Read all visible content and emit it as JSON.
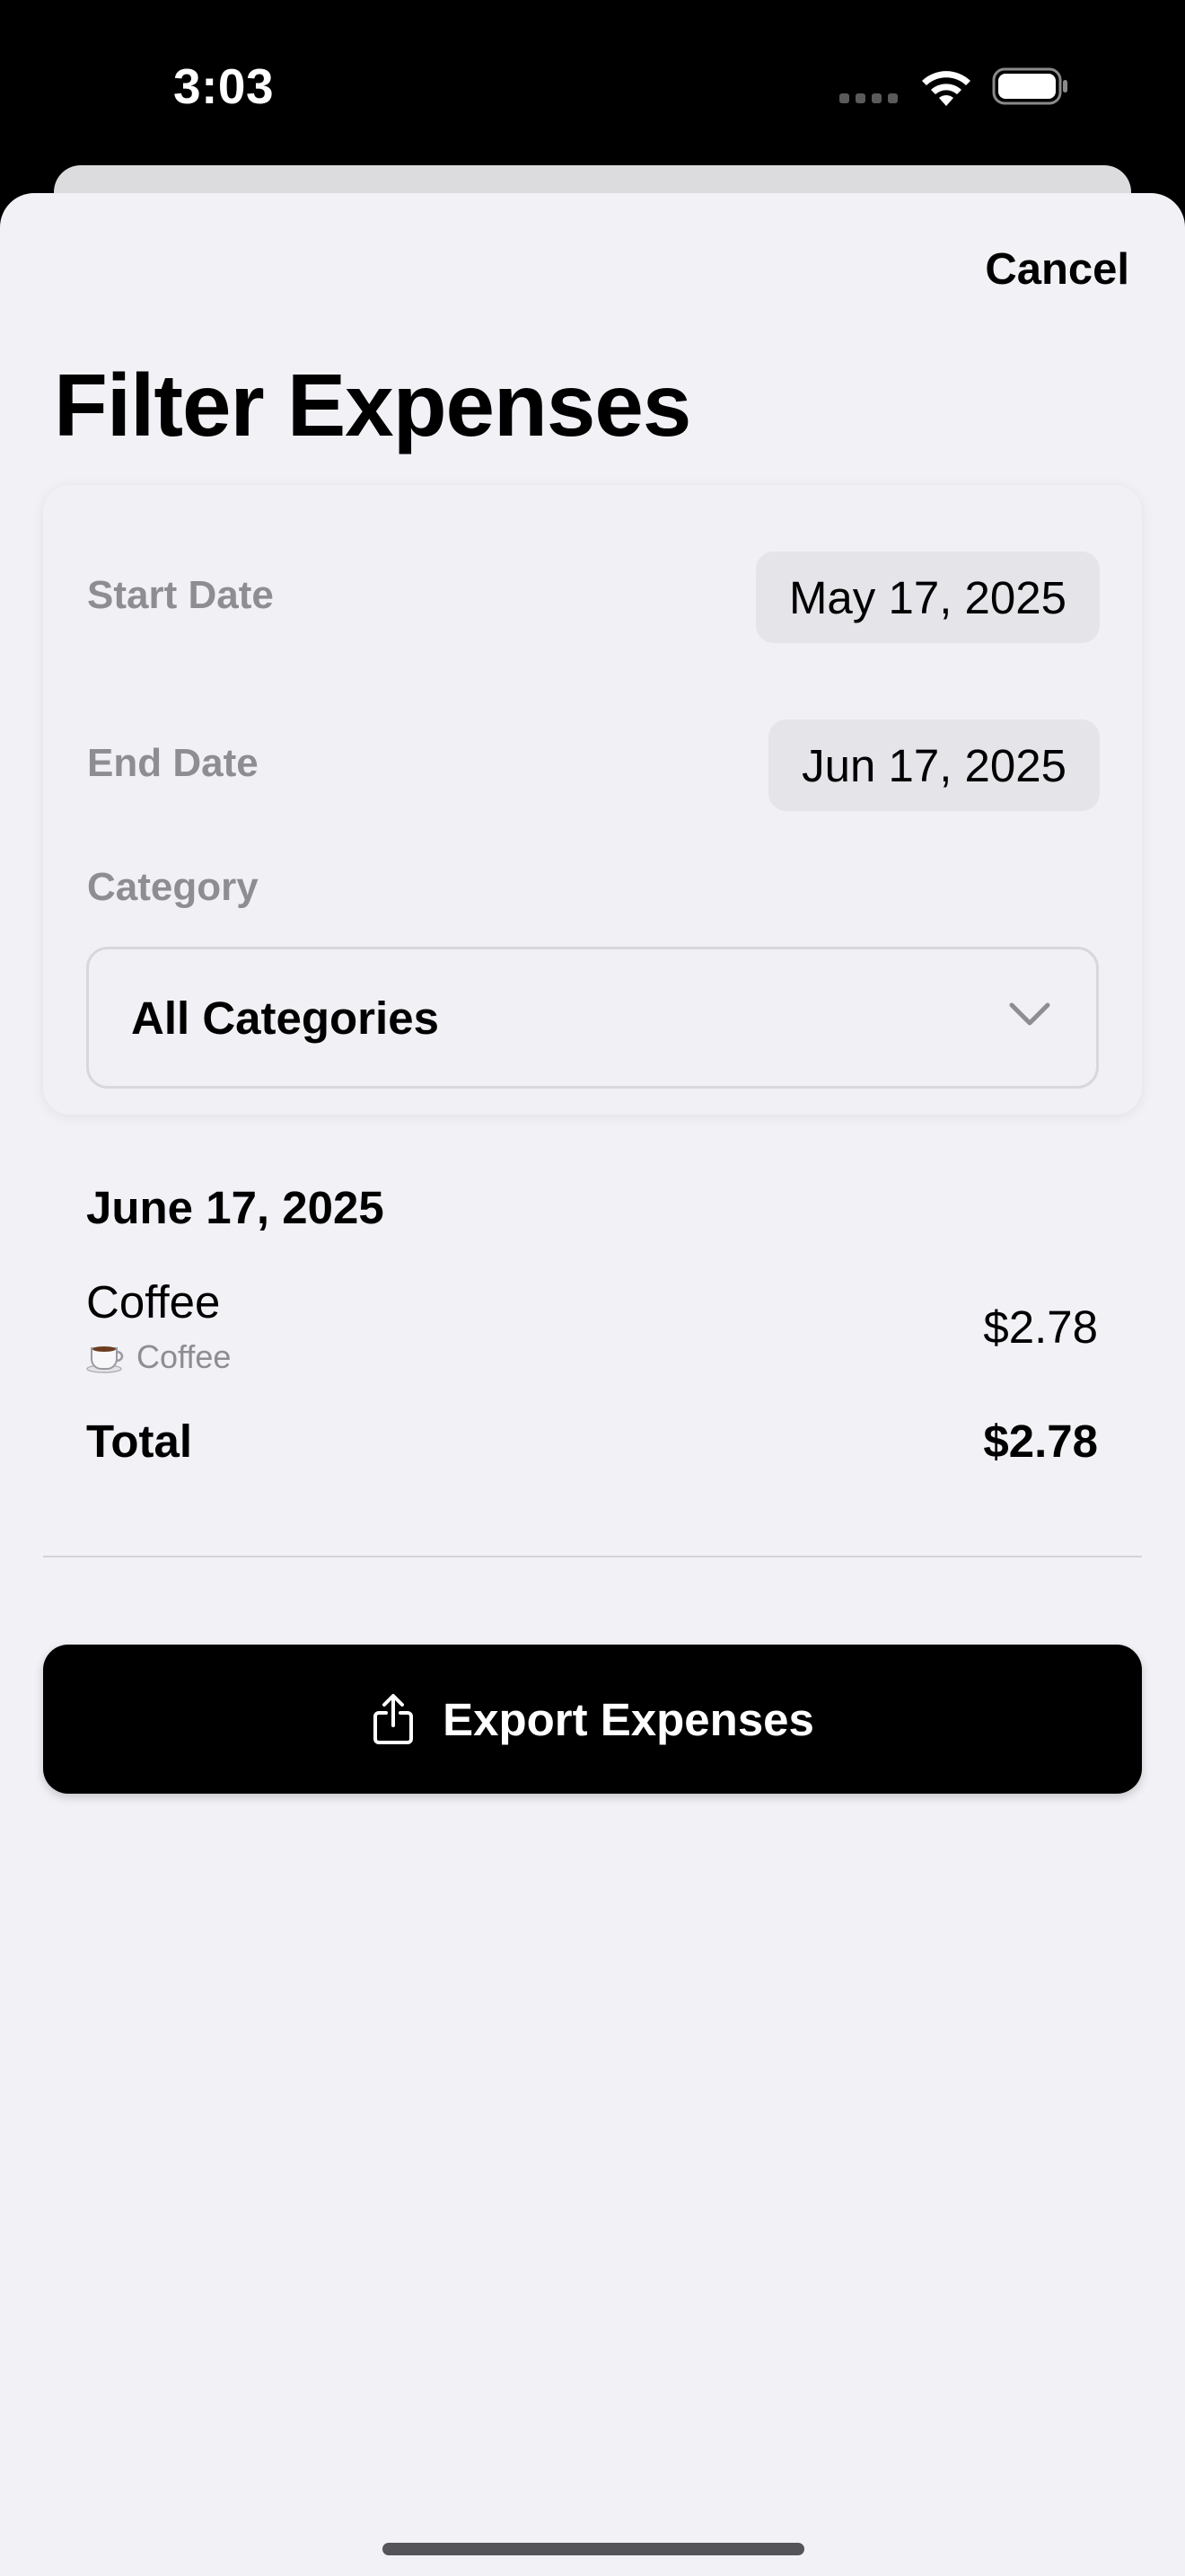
{
  "status_bar": {
    "time": "3:03"
  },
  "header": {
    "cancel_label": "Cancel",
    "title": "Filter Expenses"
  },
  "filters": {
    "start_date_label": "Start Date",
    "start_date_value": "May 17, 2025",
    "end_date_label": "End Date",
    "end_date_value": "Jun 17, 2025",
    "category_label": "Category",
    "category_value": "All Categories"
  },
  "results": {
    "groups": [
      {
        "date": "June 17, 2025",
        "expenses": [
          {
            "name": "Coffee",
            "category": "Coffee",
            "category_icon": "coffee-cup-icon",
            "amount": "$2.78"
          }
        ]
      }
    ],
    "total_label": "Total",
    "total_value": "$2.78"
  },
  "actions": {
    "export_label": "Export Expenses",
    "export_icon": "share-icon"
  },
  "colors": {
    "sheet_background": "#f2f1f6",
    "secondary_text": "#8e8e92",
    "pill_background": "#e4e4e9",
    "button_background": "#000000"
  }
}
